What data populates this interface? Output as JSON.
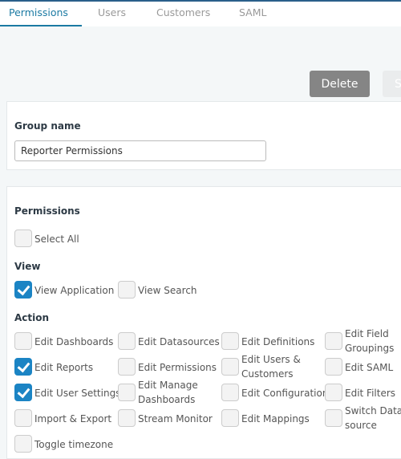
{
  "tabs": [
    {
      "label": "Permissions",
      "active": true
    },
    {
      "label": "Users"
    },
    {
      "label": "Customers"
    },
    {
      "label": "SAML"
    }
  ],
  "buttons": {
    "delete": "Delete",
    "save": "S"
  },
  "group": {
    "label": "Group name",
    "value": "Reporter Permissions"
  },
  "permissions": {
    "title": "Permissions",
    "select_all": {
      "label": "Select All",
      "checked": false
    },
    "view_title": "View",
    "view": [
      {
        "label": "View Application",
        "checked": true
      },
      {
        "label": "View Search",
        "checked": false
      }
    ],
    "action_title": "Action",
    "action": [
      {
        "label": "Edit Dashboards",
        "checked": false
      },
      {
        "label": "Edit Datasources",
        "checked": false
      },
      {
        "label": "Edit Definitions",
        "checked": false
      },
      {
        "label": "Edit Field Groupings",
        "checked": false
      },
      {
        "label": "Edit Reports",
        "checked": true
      },
      {
        "label": "Edit Permissions",
        "checked": false
      },
      {
        "label": "Edit Users & Customers",
        "checked": false
      },
      {
        "label": "Edit SAML",
        "checked": false
      },
      {
        "label": "Edit User Settings",
        "checked": true
      },
      {
        "label": "Edit Manage Dashboards",
        "checked": false
      },
      {
        "label": "Edit Configuration",
        "checked": false
      },
      {
        "label": "Edit Filters",
        "checked": false
      },
      {
        "label": "Import & Export",
        "checked": false
      },
      {
        "label": "Stream Monitor",
        "checked": false
      },
      {
        "label": "Edit Mappings",
        "checked": false
      },
      {
        "label": "Switch Data source",
        "checked": false
      },
      {
        "label": "Toggle timezone",
        "checked": false
      }
    ]
  },
  "colors": {
    "accent": "#1b7aa3",
    "checkbox": "#1b84c4",
    "delete_button": "#858585"
  }
}
